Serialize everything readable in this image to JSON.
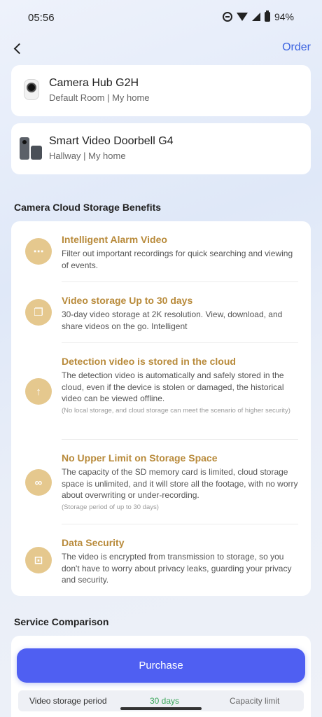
{
  "status_bar": {
    "time": "05:56",
    "battery": "94%"
  },
  "header": {
    "order_label": "Order"
  },
  "devices": [
    {
      "name": "Camera Hub G2H",
      "location": "Default Room | My home"
    },
    {
      "name": "Smart Video Doorbell G4",
      "location": "Hallway | My home"
    }
  ],
  "benefits_section": {
    "title": "Camera Cloud Storage Benefits",
    "items": [
      {
        "icon": "chat-bubble-icon",
        "title": "Intelligent Alarm Video",
        "description": "Filter out important recordings for quick searching and viewing of events.",
        "note": ""
      },
      {
        "icon": "copy-stack-icon",
        "title": "Video storage Up to 30 days",
        "description": "30-day video storage at 2K resolution. View, download, and share videos on the go. Intelligent",
        "note": ""
      },
      {
        "icon": "cloud-upload-icon",
        "title": "Detection video is stored in the cloud",
        "description": "The detection video is automatically and safely stored in the cloud, even if the device is stolen or damaged, the historical video can be viewed offline.",
        "note": "(No local storage, and cloud storage can meet the scenario of higher security)"
      },
      {
        "icon": "infinity-icon",
        "title": "No Upper Limit on Storage Space",
        "description": "The capacity of the SD memory card is limited, cloud storage space is unlimited, and it will store all the footage, with no worry about overwriting or under-recording.",
        "note": "(Storage period of up to 30 days)"
      },
      {
        "icon": "lock-icon",
        "title": "Data Security",
        "description": "The video is encrypted from transmission to storage, so you don't have to worry about privacy leaks, guarding your privacy and security.",
        "note": ""
      }
    ]
  },
  "comparison_section": {
    "title": "Service Comparison",
    "row": {
      "label": "Video storage period",
      "cloud_value": "30 days",
      "local_value": "Capacity limit"
    }
  },
  "purchase_label": "Purchase",
  "colors": {
    "accent": "#4f5ff2",
    "benefit_title": "#b88a3a",
    "icon_bg": "#e5c88e",
    "link": "#3a62e0"
  }
}
